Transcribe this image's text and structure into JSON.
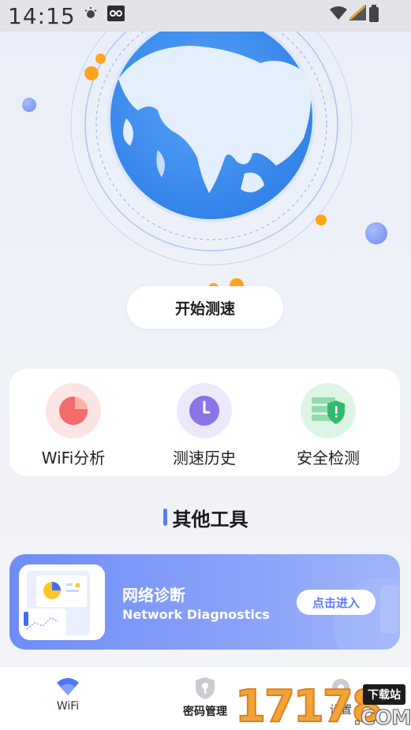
{
  "status_bar": {
    "time": "14:15"
  },
  "hero": {
    "start_button_label": "开始测速"
  },
  "tools": {
    "items": [
      {
        "label": "WiFi分析",
        "icon": "pie-chart-icon",
        "color": "#f36b6b"
      },
      {
        "label": "测速历史",
        "icon": "clock-icon",
        "color": "#8a74e8"
      },
      {
        "label": "安全检测",
        "icon": "shield-check-icon",
        "color": "#32b96b"
      }
    ]
  },
  "other_tools": {
    "title": "其他工具",
    "banner": {
      "title": "网络诊断",
      "subtitle": "Network Diagnostics",
      "button_label": "点击进入"
    }
  },
  "bottom_nav": {
    "items": [
      {
        "label": "WiFi",
        "icon": "wifi-icon",
        "active": true
      },
      {
        "label": "密码管理",
        "icon": "shield-key-icon",
        "active": false
      },
      {
        "label": "设置",
        "icon": "settings-icon",
        "active": false
      }
    ]
  },
  "watermark": {
    "digits": "17178",
    "badge": "下载站",
    "domain": ".COM"
  },
  "colors": {
    "accent": "#5b7cf5",
    "globe_blue": "#3f8ef0",
    "orange_dot": "#ffa41b"
  }
}
